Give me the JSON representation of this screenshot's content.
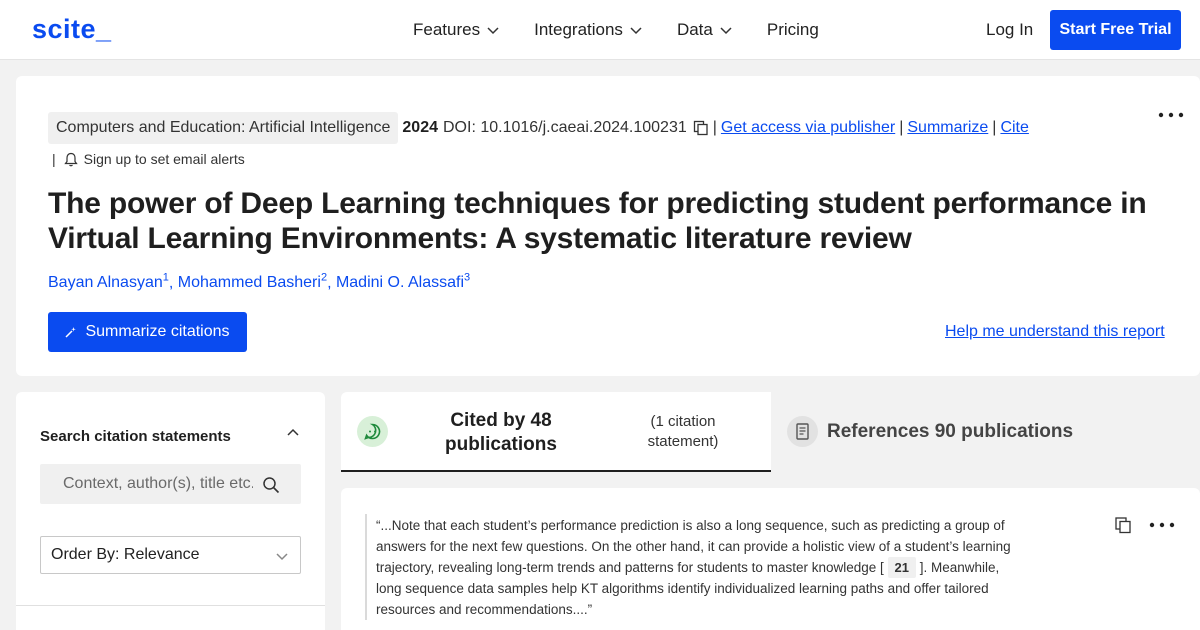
{
  "header": {
    "logo": "scite_",
    "nav": [
      "Features",
      "Integrations",
      "Data",
      "Pricing"
    ],
    "login": "Log In",
    "trial": "Start Free Trial"
  },
  "article": {
    "journal": "Computers and Education: Artificial Intelligence",
    "year": "2024",
    "doi": "DOI: 10.1016/j.caeai.2024.100231",
    "links": [
      "Get access via publisher",
      "Summarize",
      "Cite"
    ],
    "alerts": "Sign up to set email alerts",
    "title": "The power of Deep Learning techniques for predicting student performance in Virtual Learning Environments: A systematic literature review",
    "authors": [
      {
        "name": "Bayan Alnasyan",
        "sup": "1"
      },
      {
        "name": "Mohammed Basheri",
        "sup": "2"
      },
      {
        "name": "Madini O. Alassafi",
        "sup": "3"
      }
    ],
    "summarize_button": "Summarize citations",
    "help_link": "Help me understand this report"
  },
  "search": {
    "heading": "Search citation statements",
    "placeholder": "Context, author(s), title etc.",
    "order_by": "Order By: Relevance"
  },
  "tabs": {
    "cited_line1": "Cited by 48",
    "cited_line2": "publications",
    "cited_sub_line1": "(1 citation",
    "cited_sub_line2": "statement)",
    "references": "References 90 publications"
  },
  "statement": {
    "text_before": "“...Note that each student’s performance prediction is also a long sequence, such as predicting a group of answers for the next few questions. On the other hand, it can provide a holistic view of a student’s learning trajectory, revealing long-term trends and patterns for students to master knowledge [",
    "ref": "21",
    "text_after": "]. Meanwhile, long sequence data samples help KT algorithms identify individualized learning paths and offer tailored resources and recommendations....”"
  },
  "colors": {
    "brand": "#0a4bf0",
    "cite_icon_bg": "#d8f0d8",
    "cite_icon_fg": "#1f8a3c"
  }
}
